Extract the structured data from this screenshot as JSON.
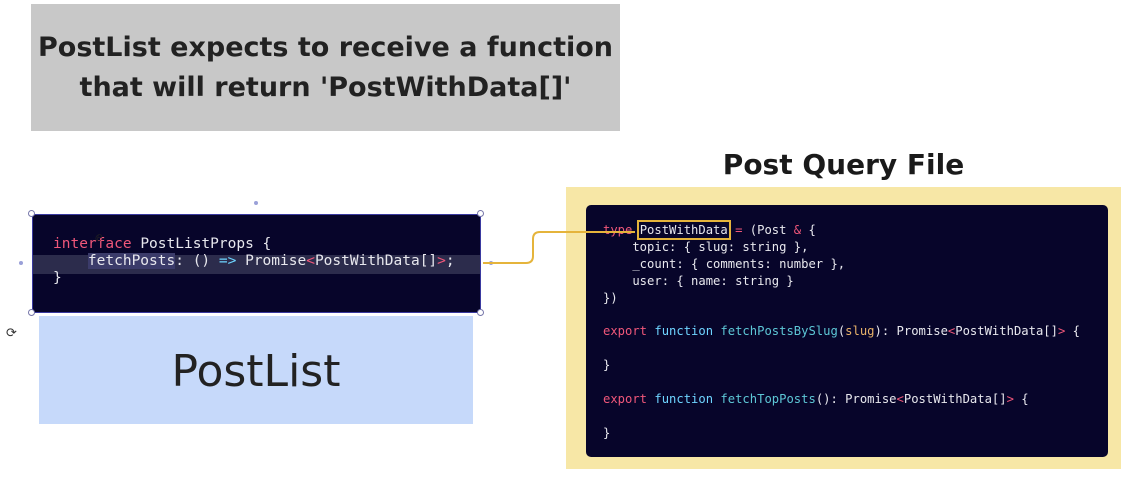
{
  "note": {
    "text": "PostList expects to receive a function\nthat will return 'PostWithData[]'"
  },
  "post_query_file": {
    "title": "Post Query File",
    "lines": [
      [
        [
          "kw",
          "type "
        ],
        [
          "box",
          "PostWithData"
        ],
        [
          "pink",
          " = "
        ],
        [
          "",
          "(Post "
        ],
        [
          "pink",
          "& "
        ],
        [
          "",
          "{"
        ]
      ],
      [
        [
          "",
          "    topic: { slug: string },"
        ]
      ],
      [
        [
          "",
          "    _count: { comments: number },"
        ]
      ],
      [
        [
          "",
          "    user: { name: string }"
        ]
      ],
      [
        [
          "",
          "})"
        ]
      ],
      [
        [
          "",
          ""
        ]
      ],
      [
        [
          "kw",
          "export "
        ],
        [
          "fn",
          "function "
        ],
        [
          "teal",
          "fetchPostsBySlug"
        ],
        [
          "",
          "("
        ],
        [
          "orng",
          "slug"
        ],
        [
          "",
          "): Promise"
        ],
        [
          "pink",
          "<"
        ],
        [
          "",
          "PostWithData[]"
        ],
        [
          "pink",
          ">"
        ],
        [
          "",
          " {"
        ]
      ],
      [
        [
          "",
          ""
        ]
      ],
      [
        [
          "",
          "}"
        ]
      ],
      [
        [
          "",
          ""
        ]
      ],
      [
        [
          "kw",
          "export "
        ],
        [
          "fn",
          "function "
        ],
        [
          "teal",
          "fetchTopPosts"
        ],
        [
          "",
          "(): Promise"
        ],
        [
          "pink",
          "<"
        ],
        [
          "",
          "PostWithData[]"
        ],
        [
          "pink",
          ">"
        ],
        [
          "",
          " {"
        ]
      ],
      [
        [
          "",
          ""
        ]
      ],
      [
        [
          "",
          "}"
        ]
      ]
    ]
  },
  "props_interface": {
    "lines": [
      [
        [
          "kw",
          "interface "
        ],
        [
          "",
          "PostListProps {"
        ]
      ],
      [
        [
          "",
          "    "
        ],
        [
          "sel",
          "fetchPosts"
        ],
        [
          "",
          ": () "
        ],
        [
          "fn",
          "=> "
        ],
        [
          "",
          "Promise"
        ],
        [
          "pink",
          "<"
        ],
        [
          "",
          "PostWithData[]"
        ],
        [
          "pink",
          ">"
        ],
        [
          "",
          ";"
        ]
      ],
      [
        [
          "",
          "}"
        ]
      ]
    ]
  },
  "postlist": {
    "label": "PostList"
  },
  "colors": {
    "accent_yellow": "#e5b43b",
    "code_bg": "#07052a",
    "postlist_fill": "#c6d9fa"
  }
}
